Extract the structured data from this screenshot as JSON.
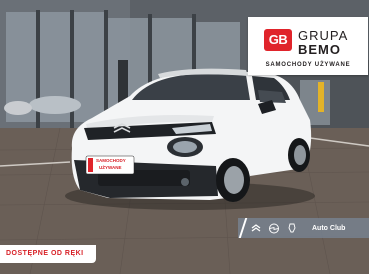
{
  "brand": {
    "logo_text": "GB",
    "name_line1": "GRUPA",
    "name_line2": "BEMO",
    "tagline": "SAMOCHODY UŻYWANE"
  },
  "license_plate": {
    "line1": "SAMOCHODY",
    "line2": "UŻYWANE"
  },
  "availability_badge": "DOSTĘPNE OD RĘKI",
  "partner_bar": {
    "label": "Auto Club",
    "icons": [
      "citroen-logo-icon",
      "opel-logo-icon",
      "peugeot-logo-icon"
    ]
  },
  "colors": {
    "accent_red": "#e0242b",
    "car_body": "#f4f5f6",
    "partner_bar": "#78828f"
  }
}
